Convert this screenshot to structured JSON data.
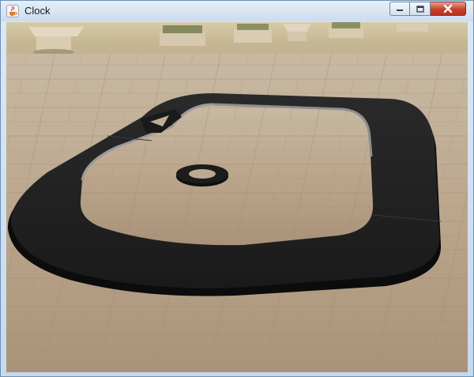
{
  "window": {
    "title": "Clock",
    "icon": "java-cup-icon",
    "controls": [
      "minimize-icon",
      "maximize-icon",
      "close-icon"
    ]
  },
  "scene": {
    "description_icons": [
      "stone-floor",
      "planter",
      "track",
      "ring"
    ]
  }
}
